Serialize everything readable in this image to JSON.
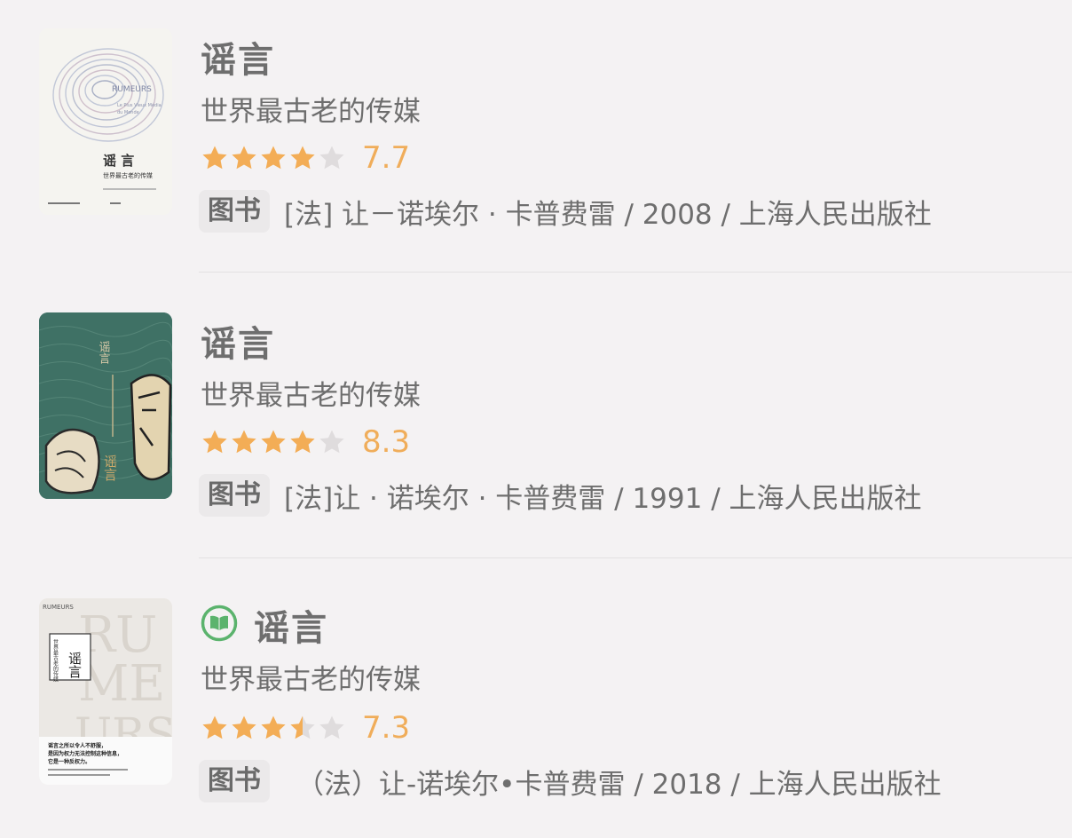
{
  "items": [
    {
      "title": "谣言",
      "subtitle": "世界最古老的传媒",
      "stars": [
        1,
        1,
        1,
        1,
        0
      ],
      "score": "7.7",
      "tag": "图书",
      "meta": "[法] 让－诺埃尔 · 卡普费雷 / 2008 / 上海人民出版社",
      "cover": {
        "title": "谣 言",
        "subtitle": "世界最古老的传媒",
        "latin": "RUMEURS",
        "latin_sub": "Le Plus Vieux Média du Monde"
      }
    },
    {
      "title": "谣言",
      "subtitle": "世界最古老的传媒",
      "stars": [
        1,
        1,
        1,
        1,
        0
      ],
      "score": "8.3",
      "tag": "图书",
      "meta": "[法]让 · 诺埃尔 · 卡普费雷 / 1991 / 上海人民出版社",
      "cover": {
        "title_top": "谣言",
        "title_bottom": "谣言"
      }
    },
    {
      "title": "谣言",
      "subtitle": "世界最古老的传媒",
      "stars": [
        1,
        1,
        1,
        0.5,
        0
      ],
      "score": "7.3",
      "tag": "图书",
      "meta": "（法）让-诺埃尔•卡普费雷 / 2018 / 上海人民出版社",
      "cover": {
        "latin_small": "RUMEURS",
        "big_letters": [
          "RU",
          "ME",
          "URS"
        ],
        "title": "谣言",
        "subtitle": "世界最古老的传媒",
        "blurb": [
          "谣言之所以令人不舒服，",
          "是因为权力无法控制这种信息，",
          "它是一种反权力。"
        ]
      }
    }
  ],
  "colors": {
    "star_on": "#f3ad56",
    "star_off": "#dfdcdd",
    "score": "#f0ad5a",
    "text": "#6e6e6e",
    "read_icon": "#5bb36d"
  },
  "icons": {
    "read": "open-book-icon",
    "star": "star-icon"
  }
}
